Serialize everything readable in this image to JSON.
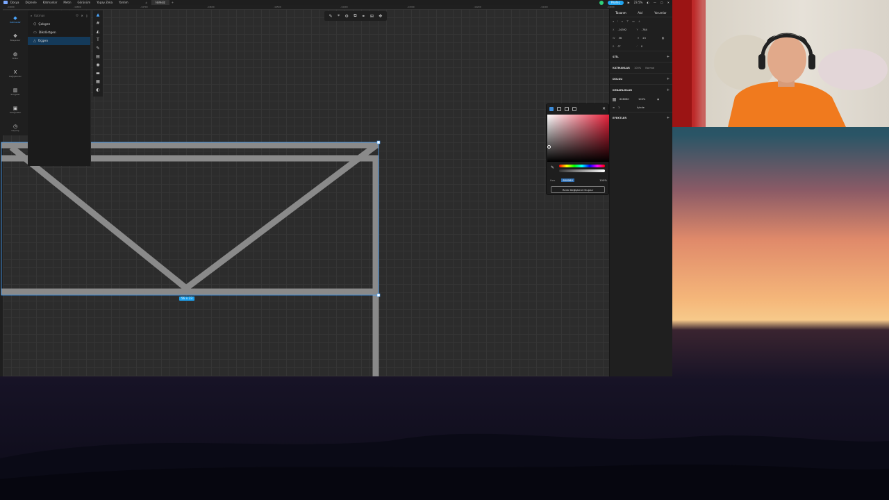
{
  "menu": {
    "items": [
      "Dosya",
      "Düzenle",
      "Katmanlar",
      "Metin",
      "Görünüm",
      "Yapay Zeka",
      "Yardım"
    ],
    "tab_label": "Isimsiz",
    "share_label": "Paylaş",
    "zoom": "23.5%"
  },
  "ruler": {
    "ticks": [
      "-14900",
      "-14800",
      "-14700",
      "-14600",
      "-14500",
      "-14400",
      "-14300",
      "-14200",
      "-14100",
      "-14000"
    ]
  },
  "left_nav": [
    {
      "label": "Katmanlar",
      "icon": "layers-icon",
      "glyph": "◆"
    },
    {
      "label": "Bileşenler",
      "icon": "components-icon",
      "glyph": "❖"
    },
    {
      "label": "Stiller",
      "icon": "styles-icon",
      "glyph": "◍"
    },
    {
      "label": "Değişkenler",
      "icon": "variables-icon",
      "glyph": "X"
    },
    {
      "label": "Simgeler",
      "icon": "icons-icon",
      "glyph": "▥"
    },
    {
      "label": "Fotoğraflar",
      "icon": "photos-icon",
      "glyph": "▣"
    },
    {
      "label": "Geçmiş",
      "icon": "history-icon",
      "glyph": "◷"
    }
  ],
  "layers_panel": {
    "search_placeholder": "Katman",
    "items": [
      {
        "name": "Çokgen",
        "icon": "polygon-icon",
        "glyph": "⬡"
      },
      {
        "name": "Dikdörtgen",
        "icon": "rectangle-icon",
        "glyph": "▭"
      },
      {
        "name": "Üçgen",
        "icon": "triangle-icon",
        "glyph": "△"
      }
    ],
    "selected_index": 2
  },
  "tools_vertical": [
    "▲",
    "#",
    "◭",
    "T",
    "✎",
    "▤",
    "◉",
    "▬",
    "▦",
    "◐"
  ],
  "tools_horizontal": [
    "✎",
    "⌖",
    "⚙",
    "⧉",
    "⚭",
    "⊞",
    "✥"
  ],
  "dimension_label": "56 × 23",
  "inspector": {
    "tabs": [
      "Tasarım",
      "Akıl",
      "Yorumlar"
    ],
    "x_label": "X",
    "x_value": "-14392",
    "y_label": "Y",
    "y_value": "-784",
    "w_label": "W",
    "w_value": "56",
    "h_label": "H",
    "h_value": "23",
    "r_label": "R",
    "r_value": "0°",
    "corner_value": "0",
    "sections": {
      "stil": "STİL",
      "katmanlar": "KATMANLAR",
      "katmanlar_opacity": "100%",
      "katmanlar_mode": "Normal",
      "dolgu": "DOLGU",
      "kenarliklar": "KENARLIKLAR",
      "stroke_hex": "808080",
      "stroke_opacity": "100%",
      "stroke_weight": "1",
      "stroke_position": "İçinde",
      "efektler": "EFEKTLER"
    }
  },
  "color_picker": {
    "hex_label": "Hex",
    "hex_value": "808080",
    "opacity": "100%",
    "create_button": "Renk Değişkeni Oluştur"
  },
  "colors": {
    "accent": "#1ba1ef",
    "shape_stroke": "#8a8a8a",
    "selection": "#4aa6ff"
  }
}
